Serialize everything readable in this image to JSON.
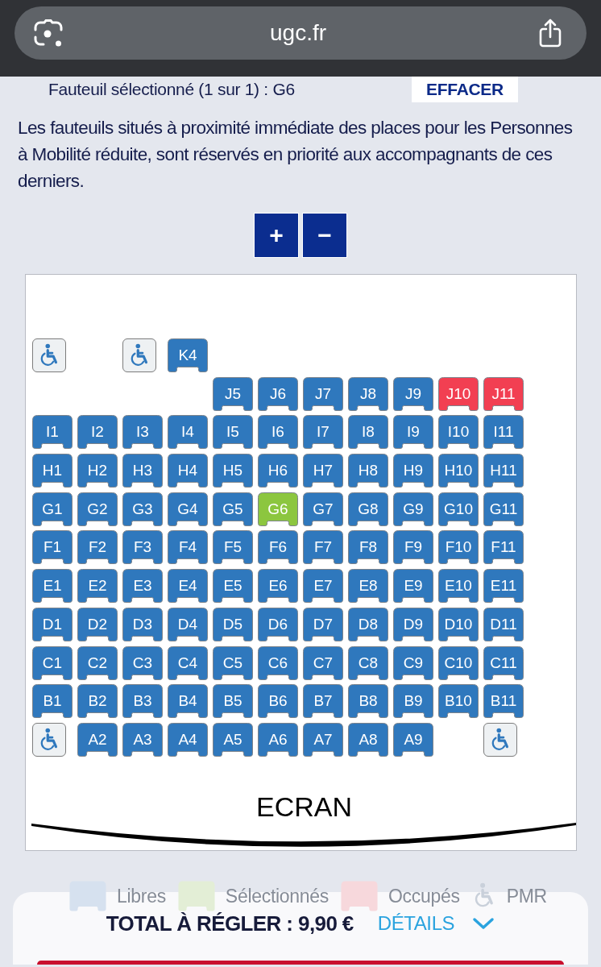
{
  "browser_bar": {
    "url": "ugc.fr"
  },
  "selection": {
    "text": "Fauteuil sélectionné (1 sur 1) : G6",
    "clear_button": "EFFACER"
  },
  "notice": "Les fauteuils situés à proximité immédiate des places pour les Personnes à Mobilité réduite, sont réservés en priorité aux accompagnants de ces derniers.",
  "zoom_buttons": [
    {
      "label": "+"
    },
    {
      "label": "−"
    }
  ],
  "seat_map": {
    "rows": [
      {
        "seats": [
          {
            "kind": "pmr",
            "selected": false
          },
          {
            "kind": "gap"
          },
          {
            "kind": "pmr",
            "selected": false
          },
          {
            "kind": "seat",
            "label": "K4",
            "selected": false,
            "occupied": false
          }
        ]
      },
      {
        "seats": [
          {
            "kind": "gap"
          },
          {
            "kind": "gap"
          },
          {
            "kind": "gap"
          },
          {
            "kind": "gap"
          },
          {
            "kind": "seat",
            "label": "J5",
            "selected": false,
            "occupied": false
          },
          {
            "kind": "seat",
            "label": "J6",
            "selected": false,
            "occupied": false
          },
          {
            "kind": "seat",
            "label": "J7",
            "selected": false,
            "occupied": false
          },
          {
            "kind": "seat",
            "label": "J8",
            "selected": false,
            "occupied": false
          },
          {
            "kind": "seat",
            "label": "J9",
            "selected": false,
            "occupied": false
          },
          {
            "kind": "seat",
            "label": "J10",
            "selected": false,
            "occupied": true
          },
          {
            "kind": "seat",
            "label": "J11",
            "selected": false,
            "occupied": true
          }
        ]
      },
      {
        "seats": [
          {
            "kind": "seat",
            "label": "I1",
            "selected": false,
            "occupied": false
          },
          {
            "kind": "seat",
            "label": "I2",
            "selected": false,
            "occupied": false
          },
          {
            "kind": "seat",
            "label": "I3",
            "selected": false,
            "occupied": false
          },
          {
            "kind": "seat",
            "label": "I4",
            "selected": false,
            "occupied": false
          },
          {
            "kind": "seat",
            "label": "I5",
            "selected": false,
            "occupied": false
          },
          {
            "kind": "seat",
            "label": "I6",
            "selected": false,
            "occupied": false
          },
          {
            "kind": "seat",
            "label": "I7",
            "selected": false,
            "occupied": false
          },
          {
            "kind": "seat",
            "label": "I8",
            "selected": false,
            "occupied": false
          },
          {
            "kind": "seat",
            "label": "I9",
            "selected": false,
            "occupied": false
          },
          {
            "kind": "seat",
            "label": "I10",
            "selected": false,
            "occupied": false
          },
          {
            "kind": "seat",
            "label": "I11",
            "selected": false,
            "occupied": false
          }
        ]
      },
      {
        "seats": [
          {
            "kind": "seat",
            "label": "H1",
            "selected": false,
            "occupied": false
          },
          {
            "kind": "seat",
            "label": "H2",
            "selected": false,
            "occupied": false
          },
          {
            "kind": "seat",
            "label": "H3",
            "selected": false,
            "occupied": false
          },
          {
            "kind": "seat",
            "label": "H4",
            "selected": false,
            "occupied": false
          },
          {
            "kind": "seat",
            "label": "H5",
            "selected": false,
            "occupied": false
          },
          {
            "kind": "seat",
            "label": "H6",
            "selected": false,
            "occupied": false
          },
          {
            "kind": "seat",
            "label": "H7",
            "selected": false,
            "occupied": false
          },
          {
            "kind": "seat",
            "label": "H8",
            "selected": false,
            "occupied": false
          },
          {
            "kind": "seat",
            "label": "H9",
            "selected": false,
            "occupied": false
          },
          {
            "kind": "seat",
            "label": "H10",
            "selected": false,
            "occupied": false
          },
          {
            "kind": "seat",
            "label": "H11",
            "selected": false,
            "occupied": false
          }
        ]
      },
      {
        "seats": [
          {
            "kind": "seat",
            "label": "G1",
            "selected": false,
            "occupied": false
          },
          {
            "kind": "seat",
            "label": "G2",
            "selected": false,
            "occupied": false
          },
          {
            "kind": "seat",
            "label": "G3",
            "selected": false,
            "occupied": false
          },
          {
            "kind": "seat",
            "label": "G4",
            "selected": false,
            "occupied": false
          },
          {
            "kind": "seat",
            "label": "G5",
            "selected": false,
            "occupied": false
          },
          {
            "kind": "seat",
            "label": "G6",
            "selected": true,
            "occupied": false
          },
          {
            "kind": "seat",
            "label": "G7",
            "selected": false,
            "occupied": false
          },
          {
            "kind": "seat",
            "label": "G8",
            "selected": false,
            "occupied": false
          },
          {
            "kind": "seat",
            "label": "G9",
            "selected": false,
            "occupied": false
          },
          {
            "kind": "seat",
            "label": "G10",
            "selected": false,
            "occupied": false
          },
          {
            "kind": "seat",
            "label": "G11",
            "selected": false,
            "occupied": false
          }
        ]
      },
      {
        "seats": [
          {
            "kind": "seat",
            "label": "F1",
            "selected": false,
            "occupied": false
          },
          {
            "kind": "seat",
            "label": "F2",
            "selected": false,
            "occupied": false
          },
          {
            "kind": "seat",
            "label": "F3",
            "selected": false,
            "occupied": false
          },
          {
            "kind": "seat",
            "label": "F4",
            "selected": false,
            "occupied": false
          },
          {
            "kind": "seat",
            "label": "F5",
            "selected": false,
            "occupied": false
          },
          {
            "kind": "seat",
            "label": "F6",
            "selected": false,
            "occupied": false
          },
          {
            "kind": "seat",
            "label": "F7",
            "selected": false,
            "occupied": false
          },
          {
            "kind": "seat",
            "label": "F8",
            "selected": false,
            "occupied": false
          },
          {
            "kind": "seat",
            "label": "F9",
            "selected": false,
            "occupied": false
          },
          {
            "kind": "seat",
            "label": "F10",
            "selected": false,
            "occupied": false
          },
          {
            "kind": "seat",
            "label": "F11",
            "selected": false,
            "occupied": false
          }
        ]
      },
      {
        "seats": [
          {
            "kind": "seat",
            "label": "E1",
            "selected": false,
            "occupied": false
          },
          {
            "kind": "seat",
            "label": "E2",
            "selected": false,
            "occupied": false
          },
          {
            "kind": "seat",
            "label": "E3",
            "selected": false,
            "occupied": false
          },
          {
            "kind": "seat",
            "label": "E4",
            "selected": false,
            "occupied": false
          },
          {
            "kind": "seat",
            "label": "E5",
            "selected": false,
            "occupied": false
          },
          {
            "kind": "seat",
            "label": "E6",
            "selected": false,
            "occupied": false
          },
          {
            "kind": "seat",
            "label": "E7",
            "selected": false,
            "occupied": false
          },
          {
            "kind": "seat",
            "label": "E8",
            "selected": false,
            "occupied": false
          },
          {
            "kind": "seat",
            "label": "E9",
            "selected": false,
            "occupied": false
          },
          {
            "kind": "seat",
            "label": "E10",
            "selected": false,
            "occupied": false
          },
          {
            "kind": "seat",
            "label": "E11",
            "selected": false,
            "occupied": false
          }
        ]
      },
      {
        "seats": [
          {
            "kind": "seat",
            "label": "D1",
            "selected": false,
            "occupied": false
          },
          {
            "kind": "seat",
            "label": "D2",
            "selected": false,
            "occupied": false
          },
          {
            "kind": "seat",
            "label": "D3",
            "selected": false,
            "occupied": false
          },
          {
            "kind": "seat",
            "label": "D4",
            "selected": false,
            "occupied": false
          },
          {
            "kind": "seat",
            "label": "D5",
            "selected": false,
            "occupied": false
          },
          {
            "kind": "seat",
            "label": "D6",
            "selected": false,
            "occupied": false
          },
          {
            "kind": "seat",
            "label": "D7",
            "selected": false,
            "occupied": false
          },
          {
            "kind": "seat",
            "label": "D8",
            "selected": false,
            "occupied": false
          },
          {
            "kind": "seat",
            "label": "D9",
            "selected": false,
            "occupied": false
          },
          {
            "kind": "seat",
            "label": "D10",
            "selected": false,
            "occupied": false
          },
          {
            "kind": "seat",
            "label": "D11",
            "selected": false,
            "occupied": false
          }
        ]
      },
      {
        "seats": [
          {
            "kind": "seat",
            "label": "C1",
            "selected": false,
            "occupied": false
          },
          {
            "kind": "seat",
            "label": "C2",
            "selected": false,
            "occupied": false
          },
          {
            "kind": "seat",
            "label": "C3",
            "selected": false,
            "occupied": false
          },
          {
            "kind": "seat",
            "label": "C4",
            "selected": false,
            "occupied": false
          },
          {
            "kind": "seat",
            "label": "C5",
            "selected": false,
            "occupied": false
          },
          {
            "kind": "seat",
            "label": "C6",
            "selected": false,
            "occupied": false
          },
          {
            "kind": "seat",
            "label": "C7",
            "selected": false,
            "occupied": false
          },
          {
            "kind": "seat",
            "label": "C8",
            "selected": false,
            "occupied": false
          },
          {
            "kind": "seat",
            "label": "C9",
            "selected": false,
            "occupied": false
          },
          {
            "kind": "seat",
            "label": "C10",
            "selected": false,
            "occupied": false
          },
          {
            "kind": "seat",
            "label": "C11",
            "selected": false,
            "occupied": false
          }
        ]
      },
      {
        "seats": [
          {
            "kind": "seat",
            "label": "B1",
            "selected": false,
            "occupied": false
          },
          {
            "kind": "seat",
            "label": "B2",
            "selected": false,
            "occupied": false
          },
          {
            "kind": "seat",
            "label": "B3",
            "selected": false,
            "occupied": false
          },
          {
            "kind": "seat",
            "label": "B4",
            "selected": false,
            "occupied": false
          },
          {
            "kind": "seat",
            "label": "B5",
            "selected": false,
            "occupied": false
          },
          {
            "kind": "seat",
            "label": "B6",
            "selected": false,
            "occupied": false
          },
          {
            "kind": "seat",
            "label": "B7",
            "selected": false,
            "occupied": false
          },
          {
            "kind": "seat",
            "label": "B8",
            "selected": false,
            "occupied": false
          },
          {
            "kind": "seat",
            "label": "B9",
            "selected": false,
            "occupied": false
          },
          {
            "kind": "seat",
            "label": "B10",
            "selected": false,
            "occupied": false
          },
          {
            "kind": "seat",
            "label": "B11",
            "selected": false,
            "occupied": false
          }
        ]
      },
      {
        "seats": [
          {
            "kind": "pmr",
            "selected": false
          },
          {
            "kind": "seat",
            "label": "A2",
            "selected": false,
            "occupied": false
          },
          {
            "kind": "seat",
            "label": "A3",
            "selected": false,
            "occupied": false
          },
          {
            "kind": "seat",
            "label": "A4",
            "selected": false,
            "occupied": false
          },
          {
            "kind": "seat",
            "label": "A5",
            "selected": false,
            "occupied": false
          },
          {
            "kind": "seat",
            "label": "A6",
            "selected": false,
            "occupied": false
          },
          {
            "kind": "seat",
            "label": "A7",
            "selected": false,
            "occupied": false
          },
          {
            "kind": "seat",
            "label": "A8",
            "selected": false,
            "occupied": false
          },
          {
            "kind": "seat",
            "label": "A9",
            "selected": false,
            "occupied": false
          },
          {
            "kind": "gap"
          },
          {
            "kind": "pmr",
            "selected": false
          }
        ]
      }
    ],
    "screen_label": "ECRAN"
  },
  "legend": [
    {
      "kind": "free",
      "label": "Libres"
    },
    {
      "kind": "selected",
      "label": "Sélectionnés"
    },
    {
      "kind": "occupied",
      "label": "Occupés"
    },
    {
      "kind": "pmr",
      "label": "PMR"
    }
  ],
  "footer": {
    "total": "TOTAL À RÉGLER : 9,90 €",
    "details_link": "DÉTAILS"
  }
}
